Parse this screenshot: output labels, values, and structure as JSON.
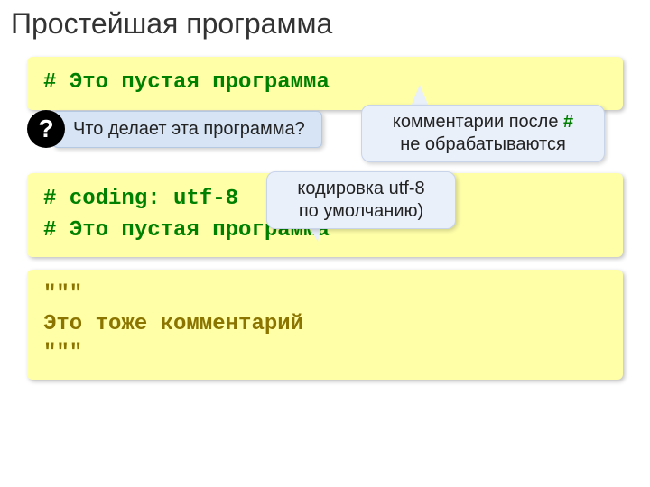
{
  "title": "Простейшая программа",
  "block1": {
    "line1": "# Это пустая программа"
  },
  "question": {
    "icon": "?",
    "text": "Что делает эта программа?"
  },
  "callout1": {
    "prefix": "комментарии после ",
    "hash": "#",
    "suffix": " не обрабатываются"
  },
  "callout2": {
    "line1": "кодировка utf-8",
    "line2": "по умолчанию)"
  },
  "block2": {
    "line1": "# coding: utf-8",
    "line2": "# Это пустая программа"
  },
  "block3": {
    "line1": "\"\"\"",
    "line2": "Это тоже комментарий",
    "line3": "\"\"\""
  }
}
